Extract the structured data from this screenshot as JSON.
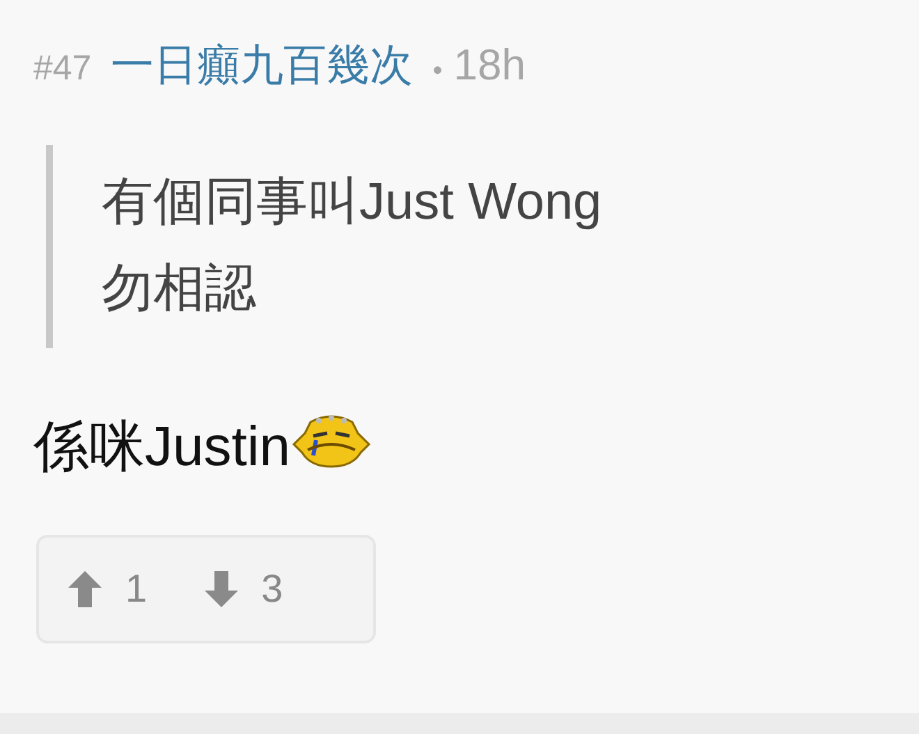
{
  "post": {
    "number": "#47",
    "author": "一日癲九百幾次",
    "separator": "•",
    "time": "18h"
  },
  "quote": {
    "lines": [
      "有個同事叫Just Wong",
      "勿相認"
    ]
  },
  "reply": {
    "text": "係咪Justin"
  },
  "votes": [
    {
      "kind": "up",
      "count": "1"
    },
    {
      "kind": "down",
      "count": "3"
    }
  ]
}
